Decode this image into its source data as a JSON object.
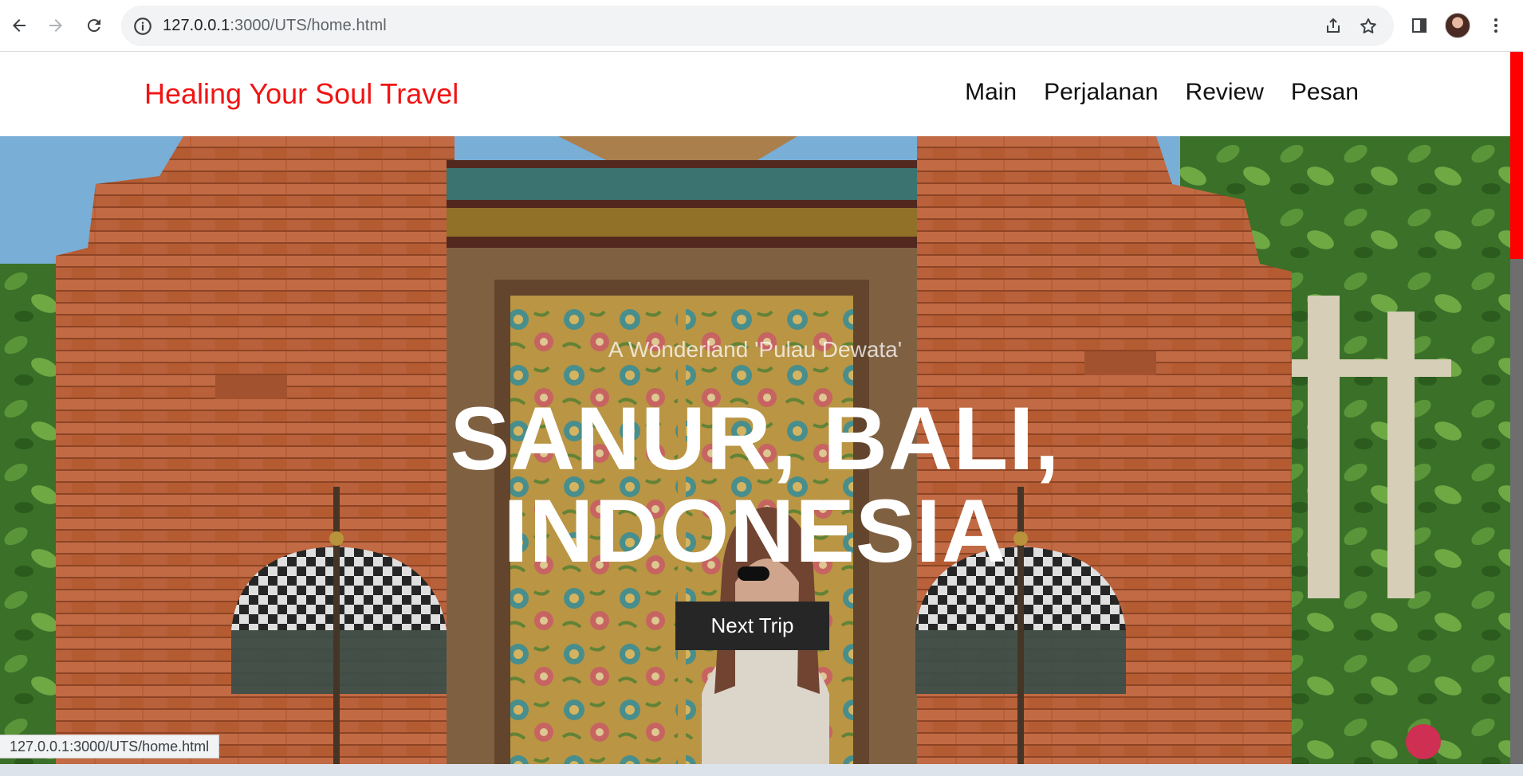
{
  "browser": {
    "url_host": "127.0.0.1",
    "url_rest": ":3000/UTS/home.html",
    "status_url": "127.0.0.1:3000/UTS/home.html"
  },
  "site": {
    "brand": "Healing Your Soul Travel",
    "nav": [
      "Main",
      "Perjalanan",
      "Review",
      "Pesan"
    ]
  },
  "hero": {
    "eyebrow": "A Wonderland 'Pulau Dewata'",
    "headline_line1": "SANUR, BALI,",
    "headline_line2": "INDONESIA",
    "cta_label": "Next Trip"
  },
  "colors": {
    "brand": "#f01414",
    "cta_bg": "#262626",
    "scroll_thumb": "#ff0000"
  },
  "icons": [
    "back-icon",
    "forward-icon",
    "reload-icon",
    "info-icon",
    "share-icon",
    "star-icon",
    "side-panel-icon",
    "avatar",
    "more-icon"
  ]
}
